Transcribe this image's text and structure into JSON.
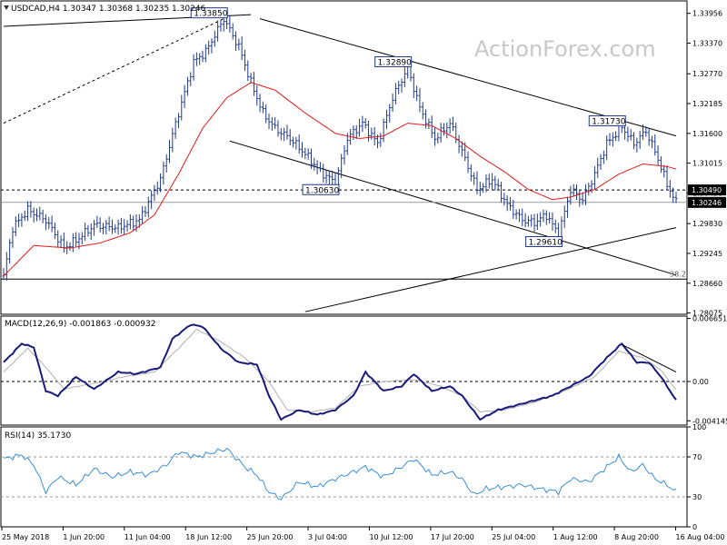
{
  "chart_data": [
    {
      "type": "candlestick",
      "title": "USDCAD,H4  1.30347 1.30368 1.30235 1.30246",
      "symbol": "USDCAD",
      "timeframe": "H4",
      "watermark": "ActionForex.com",
      "ylim": [
        1.2805,
        1.342
      ],
      "y_ticks": [
        "1.33956",
        "1.33370",
        "1.32770",
        "1.32185",
        "1.31600",
        "1.31015",
        "1.30430",
        "1.29830",
        "1.29245",
        "1.28660",
        "1.28075"
      ],
      "x_ticks": [
        "25 May 2018",
        "1 Jun 20:00",
        "11 Jun 04:00",
        "18 Jun 12:00",
        "25 Jun 20:00",
        "3 Jul 04:00",
        "10 Jul 12:00",
        "17 Jul 20:00",
        "25 Jul 04:00",
        "1 Aug 12:00",
        "8 Aug 20:00",
        "16 Aug 04:00"
      ],
      "price_tags": [
        {
          "text": "1.30490",
          "value": 1.3049,
          "style": "dark"
        },
        {
          "text": "1.30246",
          "value": 1.30246,
          "style": "dark"
        }
      ],
      "annotations": [
        "1.33850",
        "1.32890",
        "1.31730",
        "1.30630",
        "1.29610",
        "38.2"
      ],
      "fib_label": "38.2",
      "fib_level": 1.2874,
      "close_level": 1.30246,
      "dashed_level": 1.3049,
      "series": [
        {
          "name": "price",
          "color": "#203a8c",
          "anchors": [
            [
              0,
              1.288
            ],
            [
              3,
              1.2975
            ],
            [
              8,
              1.301
            ],
            [
              14,
              1.299
            ],
            [
              20,
              1.2935
            ],
            [
              24,
              1.295
            ],
            [
              30,
              1.298
            ],
            [
              38,
              1.2975
            ],
            [
              45,
              1.299
            ],
            [
              52,
              1.307
            ],
            [
              58,
              1.32
            ],
            [
              63,
              1.33
            ],
            [
              67,
              1.332
            ],
            [
              73,
              1.3385
            ],
            [
              78,
              1.333
            ],
            [
              82,
              1.326
            ],
            [
              86,
              1.32
            ],
            [
              90,
              1.317
            ],
            [
              95,
              1.315
            ],
            [
              100,
              1.312
            ],
            [
              105,
              1.3085
            ],
            [
              110,
              1.3063
            ],
            [
              114,
              1.315
            ],
            [
              119,
              1.318
            ],
            [
              124,
              1.314
            ],
            [
              129,
              1.323
            ],
            [
              134,
              1.3289
            ],
            [
              138,
              1.321
            ],
            [
              143,
              1.315
            ],
            [
              148,
              1.318
            ],
            [
              153,
              1.311
            ],
            [
              157,
              1.305
            ],
            [
              162,
              1.307
            ],
            [
              167,
              1.302
            ],
            [
              172,
              1.299
            ],
            [
              176,
              1.2985
            ],
            [
              180,
              1.3
            ],
            [
              184,
              1.2961
            ],
            [
              188,
              1.305
            ],
            [
              192,
              1.303
            ],
            [
              196,
              1.308
            ],
            [
              200,
              1.314
            ],
            [
              205,
              1.3173
            ],
            [
              209,
              1.314
            ],
            [
              213,
              1.3165
            ],
            [
              217,
              1.311
            ],
            [
              220,
              1.306
            ],
            [
              223,
              1.3024
            ]
          ]
        },
        {
          "name": "ma",
          "color": "#e01b1b",
          "anchors": [
            [
              0,
              1.288
            ],
            [
              10,
              1.294
            ],
            [
              22,
              1.2935
            ],
            [
              32,
              1.2945
            ],
            [
              42,
              1.2965
            ],
            [
              50,
              1.3
            ],
            [
              58,
              1.308
            ],
            [
              66,
              1.317
            ],
            [
              74,
              1.323
            ],
            [
              82,
              1.326
            ],
            [
              90,
              1.3245
            ],
            [
              100,
              1.32
            ],
            [
              110,
              1.316
            ],
            [
              118,
              1.315
            ],
            [
              126,
              1.3155
            ],
            [
              134,
              1.318
            ],
            [
              142,
              1.3175
            ],
            [
              150,
              1.315
            ],
            [
              158,
              1.3115
            ],
            [
              166,
              1.3085
            ],
            [
              174,
              1.305
            ],
            [
              182,
              1.303
            ],
            [
              188,
              1.3035
            ],
            [
              196,
              1.305
            ],
            [
              204,
              1.308
            ],
            [
              212,
              1.31
            ],
            [
              220,
              1.3095
            ],
            [
              223,
              1.309
            ]
          ]
        }
      ],
      "trendlines": [
        {
          "from": [
            0,
            1.337
          ],
          "to": [
            82,
            1.3393
          ],
          "style": "solid"
        },
        {
          "from": [
            0,
            1.318
          ],
          "to": [
            73,
            1.3385
          ],
          "style": "dotted"
        },
        {
          "from": [
            85,
            1.3385
          ],
          "to": [
            223,
            1.3155
          ],
          "style": "solid"
        },
        {
          "from": [
            75,
            1.3145
          ],
          "to": [
            223,
            1.2882
          ],
          "style": "solid"
        },
        {
          "from": [
            100,
            1.281
          ],
          "to": [
            223,
            1.2975
          ],
          "style": "solid"
        }
      ]
    },
    {
      "type": "line",
      "title": "MACD(12,26,9) -0.001863 -0.000932",
      "ylim": [
        -0.0046,
        0.0069
      ],
      "y_ticks": [
        "0.006651",
        "0.00",
        "-0.004145"
      ],
      "zero_level": 0.0,
      "series": [
        {
          "name": "MACD",
          "color": "#1a1a7a",
          "anchors": [
            [
              0,
              0.002
            ],
            [
              6,
              0.004
            ],
            [
              10,
              0.0036
            ],
            [
              14,
              -0.001
            ],
            [
              18,
              -0.0015
            ],
            [
              24,
              0.0005
            ],
            [
              30,
              -0.0008
            ],
            [
              38,
              0.001
            ],
            [
              44,
              0.0008
            ],
            [
              52,
              0.0015
            ],
            [
              56,
              0.0045
            ],
            [
              62,
              0.006
            ],
            [
              66,
              0.0058
            ],
            [
              72,
              0.0035
            ],
            [
              78,
              0.002
            ],
            [
              84,
              0.0018
            ],
            [
              88,
              -0.0015
            ],
            [
              92,
              -0.004
            ],
            [
              98,
              -0.003
            ],
            [
              104,
              -0.0035
            ],
            [
              110,
              -0.003
            ],
            [
              116,
              -0.0015
            ],
            [
              120,
              0.001
            ],
            [
              126,
              -0.001
            ],
            [
              132,
              -0.0005
            ],
            [
              136,
              0.0008
            ],
            [
              142,
              -0.001
            ],
            [
              148,
              -0.0005
            ],
            [
              152,
              -0.0015
            ],
            [
              158,
              -0.004
            ],
            [
              164,
              -0.003
            ],
            [
              170,
              -0.0025
            ],
            [
              176,
              -0.002
            ],
            [
              182,
              -0.0015
            ],
            [
              188,
              -0.0005
            ],
            [
              194,
              0.0005
            ],
            [
              200,
              0.0025
            ],
            [
              205,
              0.004
            ],
            [
              210,
              0.002
            ],
            [
              214,
              0.002
            ],
            [
              218,
              0.0005
            ],
            [
              223,
              -0.002
            ]
          ]
        },
        {
          "name": "Signal",
          "color": "#b0b0b0",
          "anchors": [
            [
              0,
              0.001
            ],
            [
              8,
              0.0035
            ],
            [
              14,
              0.0015
            ],
            [
              20,
              -0.0008
            ],
            [
              30,
              -0.0002
            ],
            [
              40,
              0.0005
            ],
            [
              50,
              0.001
            ],
            [
              58,
              0.0035
            ],
            [
              64,
              0.0055
            ],
            [
              72,
              0.0042
            ],
            [
              80,
              0.0025
            ],
            [
              88,
              0.0
            ],
            [
              94,
              -0.003
            ],
            [
              102,
              -0.0032
            ],
            [
              110,
              -0.0028
            ],
            [
              118,
              -0.0005
            ],
            [
              126,
              0.0
            ],
            [
              136,
              0.0002
            ],
            [
              144,
              -0.0004
            ],
            [
              152,
              -0.0015
            ],
            [
              158,
              -0.0032
            ],
            [
              166,
              -0.003
            ],
            [
              176,
              -0.0022
            ],
            [
              186,
              -0.001
            ],
            [
              196,
              0.0005
            ],
            [
              204,
              0.0032
            ],
            [
              212,
              0.0025
            ],
            [
              218,
              0.0012
            ],
            [
              223,
              -0.0009
            ]
          ]
        }
      ],
      "trendlines": [
        {
          "from": [
            205,
            0.0039
          ],
          "to": [
            223,
            0.001
          ],
          "style": "solid"
        }
      ]
    },
    {
      "type": "line",
      "title": "RSI(14) 35.1730",
      "ylim": [
        0,
        100
      ],
      "y_ticks": [
        "100",
        "70",
        "30",
        "0"
      ],
      "levels": [
        70,
        30
      ],
      "series": [
        {
          "name": "RSI",
          "color": "#3a8fd8",
          "anchors": [
            [
              0,
              68
            ],
            [
              6,
              72
            ],
            [
              10,
              62
            ],
            [
              14,
              35
            ],
            [
              18,
              50
            ],
            [
              24,
              42
            ],
            [
              30,
              58
            ],
            [
              36,
              50
            ],
            [
              42,
              55
            ],
            [
              48,
              52
            ],
            [
              54,
              62
            ],
            [
              58,
              75
            ],
            [
              64,
              70
            ],
            [
              70,
              75
            ],
            [
              74,
              78
            ],
            [
              80,
              60
            ],
            [
              84,
              52
            ],
            [
              88,
              35
            ],
            [
              92,
              28
            ],
            [
              98,
              45
            ],
            [
              104,
              40
            ],
            [
              110,
              48
            ],
            [
              116,
              55
            ],
            [
              120,
              60
            ],
            [
              126,
              50
            ],
            [
              132,
              60
            ],
            [
              136,
              68
            ],
            [
              142,
              52
            ],
            [
              148,
              55
            ],
            [
              152,
              48
            ],
            [
              156,
              32
            ],
            [
              160,
              38
            ],
            [
              166,
              40
            ],
            [
              172,
              42
            ],
            [
              178,
              38
            ],
            [
              184,
              35
            ],
            [
              188,
              48
            ],
            [
              194,
              45
            ],
            [
              200,
              60
            ],
            [
              204,
              70
            ],
            [
              208,
              55
            ],
            [
              212,
              62
            ],
            [
              216,
              48
            ],
            [
              220,
              42
            ],
            [
              223,
              35
            ]
          ]
        }
      ]
    }
  ]
}
